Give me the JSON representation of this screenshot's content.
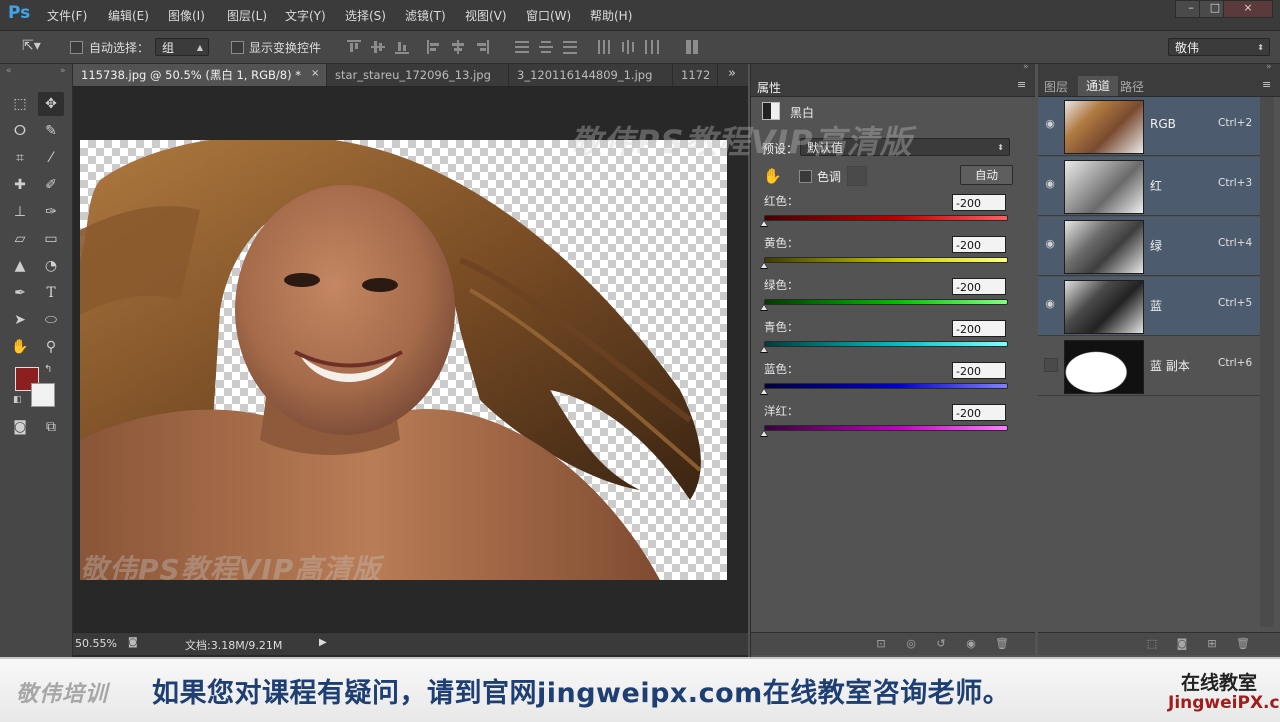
{
  "app": {
    "logo": "Ps"
  },
  "menu": [
    "文件(F)",
    "编辑(E)",
    "图像(I)",
    "图层(L)",
    "文字(Y)",
    "选择(S)",
    "滤镜(T)",
    "视图(V)",
    "窗口(W)",
    "帮助(H)"
  ],
  "window_controls": [
    "–",
    "□",
    "×"
  ],
  "options": {
    "auto_select_label": "自动选择：",
    "auto_select_value": "组",
    "show_transform_label": "显示变换控件",
    "workspace": "敬伟"
  },
  "tabs": [
    "115738.jpg @ 50.5% (黑白 1, RGB/8) *",
    "star_stareu_172096_13.jpg",
    "3_120116144809_1.jpg",
    "1172"
  ],
  "tabs_overflow": "»",
  "watermark": "敬伟PS教程VIP高清版",
  "status": {
    "zoom": "50.55%",
    "doc": "文档:3.18M/9.21M"
  },
  "properties": {
    "title": "属性",
    "adjustment": "黑白",
    "preset_label": "预设：",
    "preset_value": "默认值",
    "tint_label": "色调",
    "auto_button": "自动",
    "sliders": [
      {
        "label": "红色：",
        "value": "-200",
        "from": "#4a0000",
        "to": "#ff6060",
        "mid": "#c00000"
      },
      {
        "label": "黄色：",
        "value": "-200",
        "from": "#3d3d00",
        "to": "#ffff80",
        "mid": "#c8c800"
      },
      {
        "label": "绿色：",
        "value": "-200",
        "from": "#003d00",
        "to": "#80ff80",
        "mid": "#00c000"
      },
      {
        "label": "青色：",
        "value": "-200",
        "from": "#003d3d",
        "to": "#80ffff",
        "mid": "#00c0c0"
      },
      {
        "label": "蓝色：",
        "value": "-200",
        "from": "#00003d",
        "to": "#8080ff",
        "mid": "#0000d0"
      },
      {
        "label": "洋红：",
        "value": "-200",
        "from": "#3d003d",
        "to": "#ff80ff",
        "mid": "#c000c0"
      }
    ]
  },
  "channels_panel": {
    "tabs": [
      "图层",
      "通道",
      "路径"
    ],
    "channels": [
      {
        "name": "RGB",
        "shortcut": "Ctrl+2",
        "selected": true,
        "visible": true
      },
      {
        "name": "红",
        "shortcut": "Ctrl+3",
        "selected": true,
        "visible": true
      },
      {
        "name": "绿",
        "shortcut": "Ctrl+4",
        "selected": true,
        "visible": true
      },
      {
        "name": "蓝",
        "shortcut": "Ctrl+5",
        "selected": true,
        "visible": true
      },
      {
        "name": "蓝 副本",
        "shortcut": "Ctrl+6",
        "selected": false,
        "visible": false
      }
    ]
  },
  "colors": {
    "foreground": "#8c1f1f",
    "background": "#f2f2f2",
    "selection": "#4c5b6e"
  },
  "banner": {
    "logo": "敬伟培训",
    "text": "如果您对课程有疑问，请到官网jingweipx.com在线教室咨询老师。",
    "right_top": "在线教室",
    "right_bottom": "JingweiPX.com"
  }
}
